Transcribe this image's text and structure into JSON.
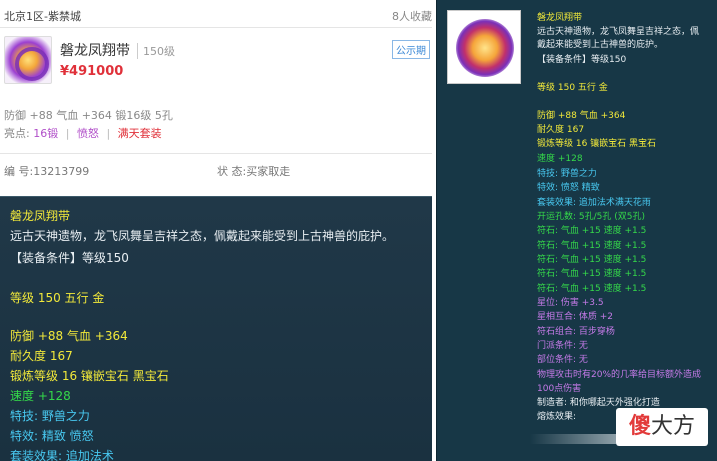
{
  "listing": {
    "server": "北京1区-紫禁城",
    "favorites": "8人收藏",
    "name": "磐龙凤翔带",
    "level": "150级",
    "price": "¥491000",
    "badge": "公示期",
    "stats": "防御 +88 气血 +364 锻16级 5孔",
    "tags_label": "亮点:",
    "tags": [
      "16锻",
      "愤怒",
      "满天套装"
    ],
    "serial": "编 号:13213799",
    "status": "状 态:买家取走"
  },
  "tooltip_left": {
    "lines": [
      {
        "text": "磐龙凤翔带",
        "color": "#f2e93a"
      },
      {
        "text": "远古天神遗物，龙飞凤舞呈吉祥之态，佩戴起来能受到上古神兽的庇护。",
        "color": "#e8eef2"
      },
      {
        "text": "【装备条件】等级150",
        "color": "#e8eef2"
      },
      {
        "text": "等级 150 五行 金",
        "color": "#f2e93a"
      },
      {
        "text": "防御 +88 气血 +364",
        "color": "#f2e93a"
      },
      {
        "text": "耐久度 167",
        "color": "#f2e93a"
      },
      {
        "text": "锻炼等级 16 镶嵌宝石 黑宝石",
        "color": "#f2e93a"
      },
      {
        "text": "速度 +128",
        "color": "#35d94a"
      },
      {
        "text": "特技:  野兽之力",
        "color": "#48c8f0"
      },
      {
        "text": "特效:  精致 愤怒",
        "color": "#48c8f0"
      },
      {
        "text": "套装效果:  追加法术",
        "color": "#48c8f0"
      }
    ]
  },
  "tooltip_right": {
    "lines": [
      {
        "text": "磐龙凤翔带",
        "color": "#f2e93a"
      },
      {
        "text": "远古天神遗物，龙飞凤舞呈吉祥之态，佩",
        "color": "#e8eef2"
      },
      {
        "text": "戴起来能受到上古神兽的庇护。",
        "color": "#e8eef2"
      },
      {
        "text": "【装备条件】等级150",
        "color": "#e8eef2"
      },
      {
        "text": "等级 150 五行 金",
        "color": "#f2e93a"
      },
      {
        "text": "防御 +88 气血 +364",
        "color": "#f2e93a"
      },
      {
        "text": "耐久度 167",
        "color": "#f2e93a"
      },
      {
        "text": "锻炼等级 16 镶嵌宝石 黑宝石",
        "color": "#f2e93a"
      },
      {
        "text": "速度 +128",
        "color": "#35d94a"
      },
      {
        "text": "特技:  野兽之力",
        "color": "#48c8f0"
      },
      {
        "text": "特效:  愤怒 精致",
        "color": "#48c8f0"
      },
      {
        "text": "套装效果:  追加法术满天花雨",
        "color": "#48c8f0"
      },
      {
        "text": "开运孔数:  5孔/5孔  (双5孔)",
        "color": "#35d94a"
      },
      {
        "text": "符石:  气血 +15 速度 +1.5",
        "color": "#35d94a"
      },
      {
        "text": "符石:  气血 +15 速度 +1.5",
        "color": "#35d94a"
      },
      {
        "text": "符石:  气血 +15 速度 +1.5",
        "color": "#35d94a"
      },
      {
        "text": "符石:  气血 +15 速度 +1.5",
        "color": "#35d94a"
      },
      {
        "text": "符石:  气血 +15 速度 +1.5",
        "color": "#35d94a"
      },
      {
        "text": "星位:  伤害 +3.5",
        "color": "#c57ae8"
      },
      {
        "text": "星相互合:  体质 +2",
        "color": "#c57ae8"
      },
      {
        "text": "符石组合:  百步穿杨",
        "color": "#c57ae8"
      },
      {
        "text": "门派条件:  无",
        "color": "#c57ae8"
      },
      {
        "text": "部位条件:  无",
        "color": "#c57ae8"
      },
      {
        "text": "物理攻击时有20%的几率给目标额外造成",
        "color": "#c57ae8"
      },
      {
        "text": "100点伤害",
        "color": "#c57ae8"
      },
      {
        "text": "制造者:  和你哪起天外强化打造",
        "color": "#e8eef2"
      },
      {
        "text": "熔炼效果:",
        "color": "#e8eef2"
      }
    ]
  },
  "watermark": {
    "char1": "傻",
    "char2": "大方"
  }
}
